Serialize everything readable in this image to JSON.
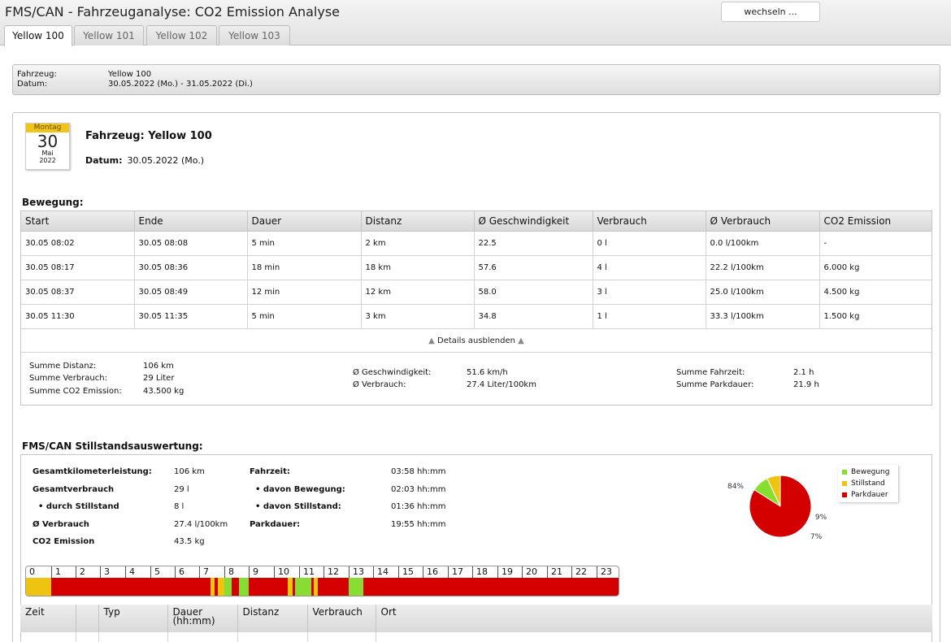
{
  "app": {
    "title": "FMS/CAN - Fahrzeuganalyse: CO2 Emission Analyse",
    "switch_button": "wechseln ..."
  },
  "tabs": [
    {
      "label": "Yellow 100",
      "active": true
    },
    {
      "label": "Yellow 101",
      "active": false
    },
    {
      "label": "Yellow 102",
      "active": false
    },
    {
      "label": "Yellow 103",
      "active": false
    }
  ],
  "header": {
    "vehicle_label": "Fahrzeug:",
    "vehicle_value": "Yellow 100",
    "date_label": "Datum:",
    "date_value": "30.05.2022 (Mo.) - 31.05.2022 (Di.)"
  },
  "calendar": {
    "weekday": "Montag",
    "day": "30",
    "month": "Mai",
    "year": "2022"
  },
  "day_header": {
    "vehicle_title": "Fahrzeug: Yellow 100",
    "date_label": "Datum:",
    "date_value": "30.05.2022 (Mo.)"
  },
  "movement": {
    "title": "Bewegung:",
    "columns": [
      "Start",
      "Ende",
      "Dauer",
      "Distanz",
      "Ø Geschwindigkeit",
      "Verbrauch",
      "Ø Verbrauch",
      "CO2 Emission"
    ],
    "rows": [
      [
        "30.05 08:02",
        "30.05 08:08",
        "5 min",
        "2 km",
        "22.5",
        "0 l",
        "0.0 l/100km",
        "-"
      ],
      [
        "30.05 08:17",
        "30.05 08:36",
        "18 min",
        "18 km",
        "57.6",
        "4 l",
        "22.2 l/100km",
        "6.000 kg"
      ],
      [
        "30.05 08:37",
        "30.05 08:49",
        "12 min",
        "12 km",
        "58.0",
        "3 l",
        "25.0 l/100km",
        "4.500 kg"
      ],
      [
        "30.05 11:30",
        "30.05 11:35",
        "5 min",
        "3 km",
        "34.8",
        "1 l",
        "33.3 l/100km",
        "1.500 kg"
      ]
    ],
    "details_toggle": "Details ausblenden",
    "summary": {
      "distance_label": "Summe Distanz:",
      "distance_value": "106 km",
      "fuel_label": "Summe Verbrauch:",
      "fuel_value": "29 Liter",
      "co2_label": "Summe CO2 Emission:",
      "co2_value": "43.500 kg",
      "speed_label": "Ø Geschwindigkeit:",
      "speed_value": "51.6 km/h",
      "avg_fuel_label": "Ø Verbrauch:",
      "avg_fuel_value": "27.4 Liter/100km",
      "drive_time_label": "Summe Fahrzeit:",
      "drive_time_value": "2.1 h",
      "park_label": "Summe Parkdauer:",
      "park_value": "21.9 h"
    }
  },
  "standstill": {
    "title": "FMS/CAN Stillstandsauswertung:",
    "total_km_label": "Gesamtkilometerleistung:",
    "total_km_value": "106 km",
    "total_fuel_label": "Gesamtverbrauch",
    "total_fuel_value": "29 l",
    "standstill_fuel_label": "• durch Stillstand",
    "standstill_fuel_value": "8 l",
    "avg_fuel_label": "Ø Verbrauch",
    "avg_fuel_value": "27.4 l/100km",
    "co2_label": "CO2 Emission",
    "co2_value": "43.5 kg",
    "drive_time_label": "Fahrzeit:",
    "drive_time_value": "03:58 hh:mm",
    "movement_label": "• davon Bewegung:",
    "movement_value": "02:03 hh:mm",
    "idle_label": "• davon Stillstand:",
    "idle_value": "01:36 hh:mm",
    "park_label": "Parkdauer:",
    "park_value": "19:55 hh:mm"
  },
  "chart_data": {
    "type": "pie",
    "title": "",
    "slices": [
      {
        "label": "Bewegung",
        "value": 9,
        "display": "9%",
        "color": "#88dd33"
      },
      {
        "label": "Stillstand",
        "value": 7,
        "display": "7%",
        "color": "#eec411"
      },
      {
        "label": "Parkdauer",
        "value": 84,
        "display": "84%",
        "color": "#d40000"
      }
    ],
    "legend_position": "top-right"
  },
  "timeline": {
    "hours": [
      "0",
      "1",
      "2",
      "3",
      "4",
      "5",
      "6",
      "7",
      "8",
      "9",
      "10",
      "11",
      "12",
      "13",
      "14",
      "15",
      "16",
      "17",
      "18",
      "19",
      "20",
      "21",
      "22",
      "23"
    ],
    "segments": [
      {
        "start": 0.0,
        "end": 1.0,
        "state": "Stillstand"
      },
      {
        "start": 1.0,
        "end": 7.45,
        "state": "Parkdauer"
      },
      {
        "start": 7.45,
        "end": 7.6,
        "state": "Stillstand"
      },
      {
        "start": 7.6,
        "end": 7.75,
        "state": "Parkdauer"
      },
      {
        "start": 7.75,
        "end": 8.0,
        "state": "Stillstand"
      },
      {
        "start": 8.0,
        "end": 8.3,
        "state": "Bewegung"
      },
      {
        "start": 8.3,
        "end": 8.6,
        "state": "Parkdauer"
      },
      {
        "start": 8.6,
        "end": 9.0,
        "state": "Bewegung"
      },
      {
        "start": 9.0,
        "end": 10.55,
        "state": "Parkdauer"
      },
      {
        "start": 10.55,
        "end": 10.75,
        "state": "Stillstand"
      },
      {
        "start": 10.75,
        "end": 10.85,
        "state": "Parkdauer"
      },
      {
        "start": 10.85,
        "end": 11.5,
        "state": "Bewegung"
      },
      {
        "start": 11.5,
        "end": 11.6,
        "state": "Parkdauer"
      },
      {
        "start": 11.6,
        "end": 11.75,
        "state": "Stillstand"
      },
      {
        "start": 11.75,
        "end": 13.0,
        "state": "Parkdauer"
      },
      {
        "start": 13.0,
        "end": 13.6,
        "state": "Bewegung"
      },
      {
        "start": 13.6,
        "end": 24.0,
        "state": "Parkdauer"
      }
    ],
    "colors": {
      "Bewegung": "#88dd33",
      "Stillstand": "#eec411",
      "Parkdauer": "#d40000"
    }
  },
  "stops_table": {
    "columns": [
      "Zeit",
      "",
      "Typ",
      "Dauer\n(hh:mm)",
      "Distanz",
      "Verbrauch",
      "Ort"
    ]
  }
}
